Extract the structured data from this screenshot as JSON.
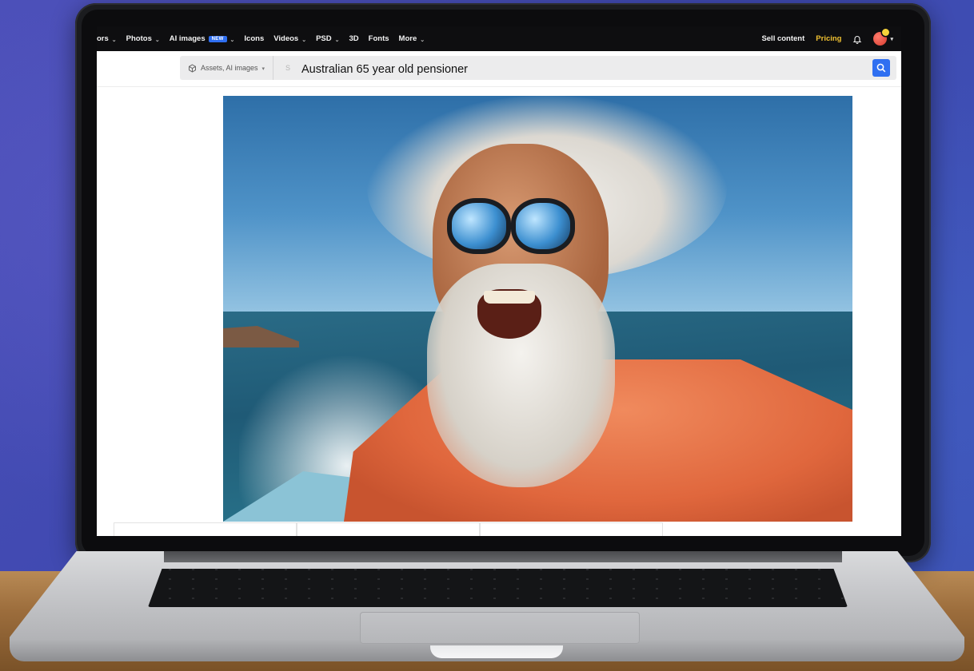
{
  "nav": {
    "items": [
      {
        "label": "ors",
        "dropdown": true
      },
      {
        "label": "Photos",
        "dropdown": true
      },
      {
        "label": "AI images",
        "badge": "NEW",
        "dropdown": true
      },
      {
        "label": "Icons",
        "dropdown": false
      },
      {
        "label": "Videos",
        "dropdown": true
      },
      {
        "label": "PSD",
        "dropdown": true
      },
      {
        "label": "3D",
        "dropdown": false
      },
      {
        "label": "Fonts",
        "dropdown": false
      },
      {
        "label": "More",
        "dropdown": true
      }
    ],
    "sell_content": "Sell content",
    "pricing": "Pricing",
    "icons": {
      "bell": "bell-icon",
      "avatar": "user-avatar",
      "chevron": "chevron-down-icon"
    }
  },
  "search": {
    "scope_label": "Assets, AI images",
    "stub_char": "S",
    "query": "Australian 65 year old pensioner",
    "button_icon": "search-icon"
  },
  "hero": {
    "icon": "generated-photo",
    "subject": "photo"
  },
  "colors": {
    "accent": "#2f6ff1",
    "pricing": "#f1c232",
    "nav_bg": "#0e0e10"
  }
}
